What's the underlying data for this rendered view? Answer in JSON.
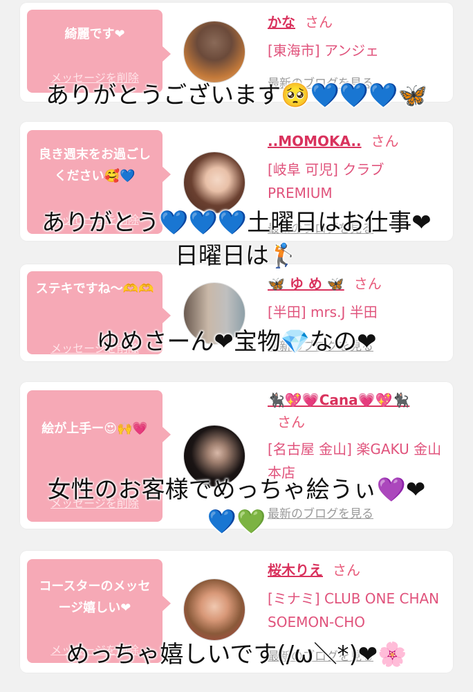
{
  "cards": [
    {
      "message": "綺麗です❤",
      "delete_label": "メッセージを削除",
      "name": "かな",
      "honorific": "さん",
      "shop": "[東海市] アンジェ",
      "blog_label": "最新のブログを見る"
    },
    {
      "message": "良き週末をお過ごしください🥰💙",
      "delete_label": "メッセージを削除",
      "name": "..MOMOKA..",
      "honorific": "さん",
      "shop": "[岐阜 可児] クラブ PREMIUM",
      "blog_label": "最新のブログを見る"
    },
    {
      "message": "ステキですね〜🫶🫶",
      "delete_label": "メッセージを削除",
      "name": "🦋 ゆ め 🦋",
      "honorific": "さん",
      "shop": "[半田] mrs.J 半田",
      "blog_label": "最新のブログを見る"
    },
    {
      "message": "絵が上手ー😍🙌💗",
      "delete_label": "メッセージを削除",
      "name": "🐈‍⬛💖💗Cana💗💖🐈‍⬛",
      "honorific": "さん",
      "shop": "[名古屋 金山] 楽GAKU 金山本店",
      "blog_label": "最新のブログを見る"
    },
    {
      "message": "コースターのメッセージ嬉しい❤",
      "delete_label": "メッセージを削除",
      "name": "桜木りえ",
      "honorific": "さん",
      "shop": "[ミナミ] CLUB ONE CHAN SOEMON-CHO",
      "blog_label": "最新のブログを見る"
    }
  ],
  "overlays": [
    "ありがとうございます🥺💙💙💙🦋",
    "ありがとう💙💙💙土曜日はお仕事❤",
    "日曜日は🏌",
    "ゆめさーん❤宝物💎なの❤",
    "女性のお客様でめっちゃ絵うぃ💜❤",
    "💙💚",
    "めっちゃ嬉しいです(/ω＼*)❤🌸"
  ],
  "colors": {
    "accent_pink": "#f6a9b6",
    "name_red": "#d9325d",
    "shop_pink": "#e0537c",
    "link_gray": "#9a9a9a"
  }
}
